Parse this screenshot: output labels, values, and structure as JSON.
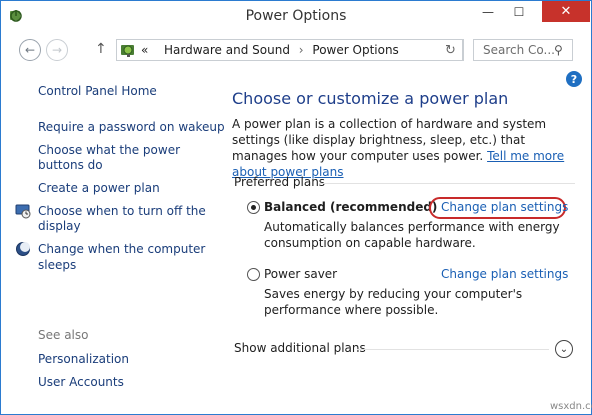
{
  "window": {
    "title": "Power Options",
    "min_glyph": "—",
    "max_glyph": "☐",
    "close_glyph": "✕"
  },
  "nav": {
    "back_glyph": "←",
    "forward_glyph": "→",
    "up_glyph": "↑",
    "breadcrumb_prefix": "«",
    "breadcrumb": [
      "Hardware and Sound",
      "Power Options"
    ],
    "breadcrumb_sep": "›",
    "dropdown_glyph": "▾",
    "refresh_glyph": "↻",
    "search_placeholder": "Search Co...",
    "search_glyph": "⚲"
  },
  "help_glyph": "?",
  "sidebar": {
    "home": "Control Panel Home",
    "links": [
      "Require a password on wakeup",
      "Choose what the power",
      "buttons do",
      "Create a power plan",
      "Choose when to turn off the",
      "display",
      "Change when the computer",
      "sleeps"
    ],
    "see_also_label": "See also",
    "see_also": [
      "Personalization",
      "User Accounts"
    ]
  },
  "main": {
    "heading": "Choose or customize a power plan",
    "description": "A power plan is a collection of hardware and system settings (like display brightness, sleep, etc.) that manages how your computer uses power. ",
    "description_link": "Tell me more about power plans",
    "preferred_label": "Preferred plans",
    "plans": [
      {
        "name": "Balanced (recommended)",
        "selected": true,
        "description": "Automatically balances performance with energy consumption on capable hardware.",
        "change_link": "Change plan settings"
      },
      {
        "name": "Power saver",
        "selected": false,
        "description": "Saves energy by reducing your computer's performance where possible.",
        "change_link": "Change plan settings"
      }
    ],
    "show_more": "Show additional plans",
    "expand_glyph": "⌄"
  },
  "watermark": "wsxdn.com",
  "colors": {
    "link": "#1a5fb4",
    "heading": "#1e3e8a",
    "close": "#c7322b",
    "highlight": "#c82a2a"
  }
}
